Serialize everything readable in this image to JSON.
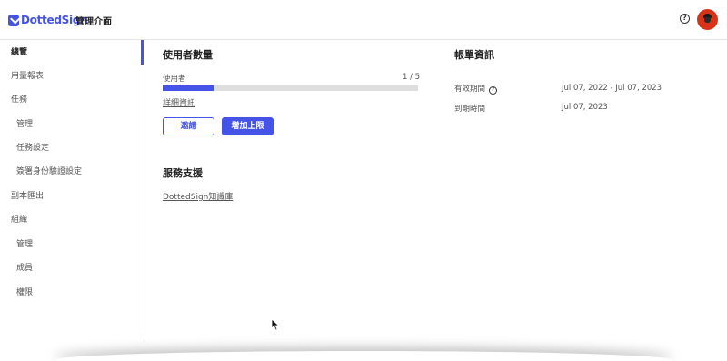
{
  "header": {
    "logo_text": "DottedSign",
    "app_title": "管理介面"
  },
  "sidebar": {
    "items": [
      {
        "label": "總覽"
      },
      {
        "label": "用量報表"
      },
      {
        "label": "任務"
      },
      {
        "label": "管理"
      },
      {
        "label": "任務設定"
      },
      {
        "label": "簽署身份驗證設定"
      },
      {
        "label": "副本匯出"
      },
      {
        "label": "組織"
      },
      {
        "label": "管理"
      },
      {
        "label": "成員"
      },
      {
        "label": "權限"
      }
    ]
  },
  "users": {
    "title": "使用者數量",
    "label": "使用者",
    "count": "1 / 5",
    "progress_fraction": 0.2,
    "details_link": "詳細資訊",
    "invite_label": "邀請",
    "increase_label": "增加上限"
  },
  "billing": {
    "title": "帳單資訊",
    "valid_label": "有效期間",
    "valid_value": "Jul 07, 2022 - Jul 07, 2023",
    "expire_label": "到期時間",
    "expire_value": "Jul 07, 2023"
  },
  "support": {
    "title": "服務支援",
    "link": "DottedSign知識庫"
  },
  "colors": {
    "accent": "#4553e6",
    "avatar": "#d63418"
  }
}
